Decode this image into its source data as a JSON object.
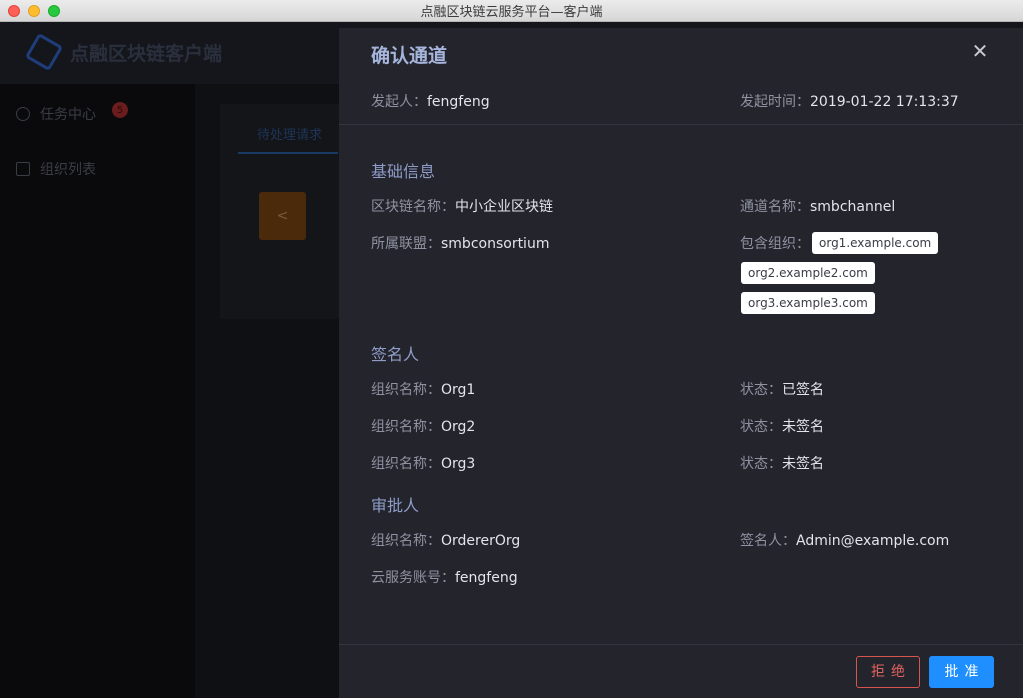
{
  "window": {
    "title": "点融区块链云服务平台—客户端"
  },
  "app": {
    "name": "点融区块链客户端",
    "sidebar": [
      {
        "label": "任务中心",
        "badge": "5"
      },
      {
        "label": "组织列表"
      }
    ],
    "tab": "待处理请求"
  },
  "drawer": {
    "title": "确认通道",
    "initiator_label": "发起人：",
    "initiator": "fengfeng",
    "time_label": "发起时间：",
    "time": "2019-01-22 17:13:37",
    "basic": {
      "heading": "基础信息",
      "chain_label": "区块链名称：",
      "chain": "中小企业区块链",
      "channel_label": "通道名称：",
      "channel": "smbchannel",
      "consortium_label": "所属联盟：",
      "consortium": "smbconsortium",
      "orgs_label": "包含组织：",
      "orgs": [
        "org1.example.com",
        "org2.example2.com",
        "org3.example3.com"
      ]
    },
    "signers": {
      "heading": "签名人",
      "org_label": "组织名称：",
      "status_label": "状态：",
      "rows": [
        {
          "org": "Org1",
          "status": "已签名"
        },
        {
          "org": "Org2",
          "status": "未签名"
        },
        {
          "org": "Org3",
          "status": "未签名"
        }
      ]
    },
    "approver": {
      "heading": "审批人",
      "org_label": "组织名称：",
      "org": "OrdererOrg",
      "signer_label": "签名人：",
      "signer": "Admin@example.com",
      "account_label": "云服务账号：",
      "account": "fengfeng"
    },
    "actions": {
      "reject": "拒绝",
      "approve": "批准"
    }
  }
}
